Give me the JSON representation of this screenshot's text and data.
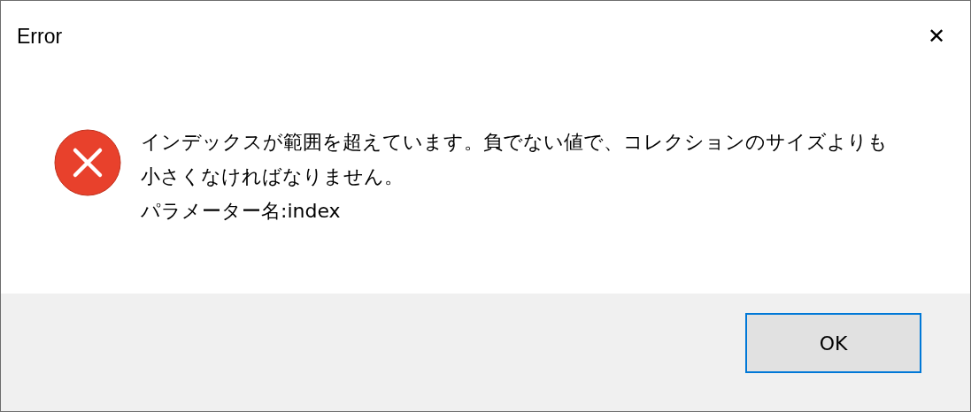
{
  "window": {
    "title": "Error",
    "close": "✕"
  },
  "message": {
    "kind": "error",
    "lines": [
      "インデックスが範囲を超えています。負でない値で、コレクションのサイズよりも",
      "小さくなければなりません。",
      "パラメーター名:index"
    ]
  },
  "buttons": [
    {
      "label": "OK",
      "selected": true
    }
  ]
}
